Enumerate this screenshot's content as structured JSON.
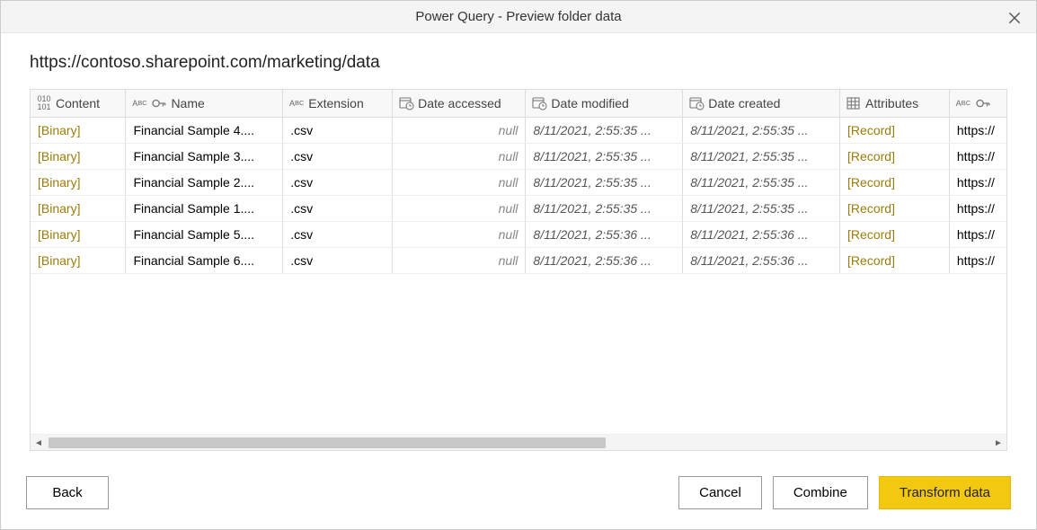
{
  "title": "Power Query - Preview folder data",
  "path": "https://contoso.sharepoint.com/marketing/data",
  "columns": {
    "content": "Content",
    "name": "Name",
    "extension": "Extension",
    "accessed": "Date accessed",
    "modified": "Date modified",
    "created": "Date created",
    "attributes": "Attributes",
    "folderpath": ""
  },
  "rows": [
    {
      "content": "[Binary]",
      "name": "Financial Sample 4....",
      "ext": ".csv",
      "accessed": "null",
      "modified": "8/11/2021, 2:55:35 ...",
      "created": "8/11/2021, 2:55:35 ...",
      "attr": "[Record]",
      "path": "https://"
    },
    {
      "content": "[Binary]",
      "name": "Financial Sample 3....",
      "ext": ".csv",
      "accessed": "null",
      "modified": "8/11/2021, 2:55:35 ...",
      "created": "8/11/2021, 2:55:35 ...",
      "attr": "[Record]",
      "path": "https://"
    },
    {
      "content": "[Binary]",
      "name": "Financial Sample 2....",
      "ext": ".csv",
      "accessed": "null",
      "modified": "8/11/2021, 2:55:35 ...",
      "created": "8/11/2021, 2:55:35 ...",
      "attr": "[Record]",
      "path": "https://"
    },
    {
      "content": "[Binary]",
      "name": "Financial Sample 1....",
      "ext": ".csv",
      "accessed": "null",
      "modified": "8/11/2021, 2:55:35 ...",
      "created": "8/11/2021, 2:55:35 ...",
      "attr": "[Record]",
      "path": "https://"
    },
    {
      "content": "[Binary]",
      "name": "Financial Sample 5....",
      "ext": ".csv",
      "accessed": "null",
      "modified": "8/11/2021, 2:55:36 ...",
      "created": "8/11/2021, 2:55:36 ...",
      "attr": "[Record]",
      "path": "https://"
    },
    {
      "content": "[Binary]",
      "name": "Financial Sample 6....",
      "ext": ".csv",
      "accessed": "null",
      "modified": "8/11/2021, 2:55:36 ...",
      "created": "8/11/2021, 2:55:36 ...",
      "attr": "[Record]",
      "path": "https://"
    }
  ],
  "buttons": {
    "back": "Back",
    "cancel": "Cancel",
    "combine": "Combine",
    "transform": "Transform data"
  }
}
